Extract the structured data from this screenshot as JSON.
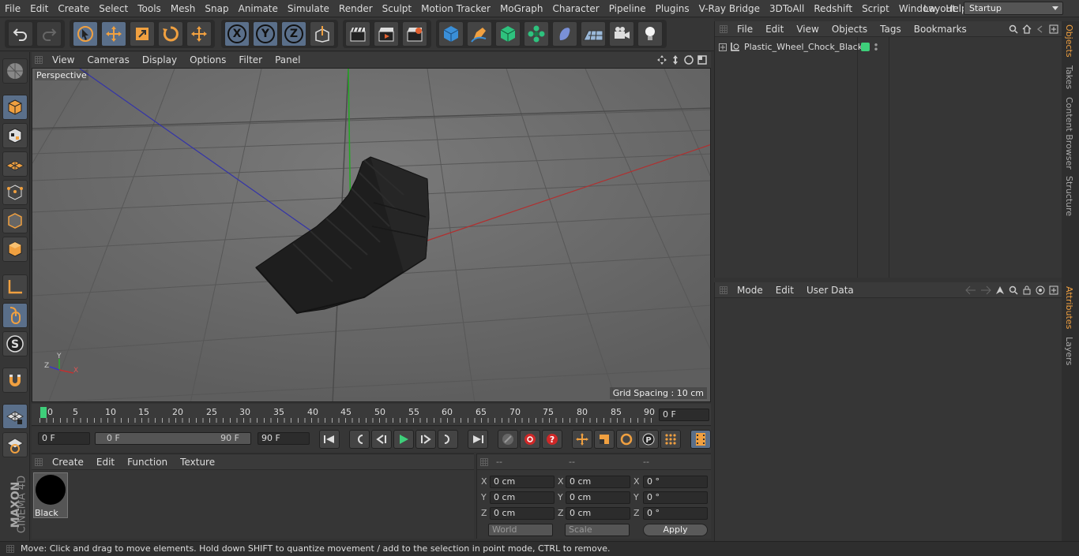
{
  "menubar": {
    "items": [
      "File",
      "Edit",
      "Create",
      "Select",
      "Tools",
      "Mesh",
      "Snap",
      "Animate",
      "Simulate",
      "Render",
      "Sculpt",
      "Motion Tracker",
      "MoGraph",
      "Character",
      "Pipeline",
      "Plugins",
      "V-Ray Bridge",
      "3DToAll",
      "Redshift",
      "Script",
      "Window",
      "Help"
    ],
    "layout_label": "Layout:",
    "layout_value": "Startup"
  },
  "toolbar": {
    "axis_x": "X",
    "axis_y": "Y",
    "axis_z": "Z"
  },
  "viewport": {
    "menu": [
      "View",
      "Cameras",
      "Display",
      "Options",
      "Filter",
      "Panel"
    ],
    "label": "Perspective",
    "grid_spacing": "Grid Spacing : 10 cm",
    "axis_x": "X",
    "axis_y": "Y",
    "axis_z": "Z"
  },
  "timeline": {
    "ticks": [
      "0",
      "5",
      "10",
      "15",
      "20",
      "25",
      "30",
      "35",
      "40",
      "45",
      "50",
      "55",
      "60",
      "65",
      "70",
      "75",
      "80",
      "85",
      "90"
    ],
    "current_frame": "0 F"
  },
  "transport": {
    "start": "0 F",
    "range_start": "0 F",
    "range_end": "90 F",
    "end": "90 F"
  },
  "materials": {
    "menu": [
      "Create",
      "Edit",
      "Function",
      "Texture"
    ],
    "items": [
      {
        "name": "Black",
        "color": "#000000"
      }
    ]
  },
  "coords": {
    "headers": [
      "--",
      "--",
      "--"
    ],
    "rows": [
      {
        "axis": "X",
        "pos": "0 cm",
        "size": "0 cm",
        "rot": "0 °"
      },
      {
        "axis": "Y",
        "pos": "0 cm",
        "size": "0 cm",
        "rot": "0 °"
      },
      {
        "axis": "Z",
        "pos": "0 cm",
        "size": "0 cm",
        "rot": "0 °"
      }
    ],
    "space": "World",
    "mode": "Scale",
    "apply": "Apply"
  },
  "objects": {
    "menu": [
      "File",
      "Edit",
      "View",
      "Objects",
      "Tags",
      "Bookmarks"
    ],
    "items": [
      {
        "name": "Plastic_Wheel_Chock_Black",
        "layer_color": "#3ecf7a"
      }
    ]
  },
  "attributes": {
    "menu": [
      "Mode",
      "Edit",
      "User Data"
    ]
  },
  "right_tabs": [
    "Objects",
    "Takes",
    "Content Browser",
    "Structure",
    "Attributes",
    "Layers"
  ],
  "status": "Move: Click and drag to move elements. Hold down SHIFT to quantize movement / add to the selection in point mode, CTRL to remove.",
  "brand": {
    "line1": "MAXON",
    "line2": "CINEMA 4D"
  }
}
